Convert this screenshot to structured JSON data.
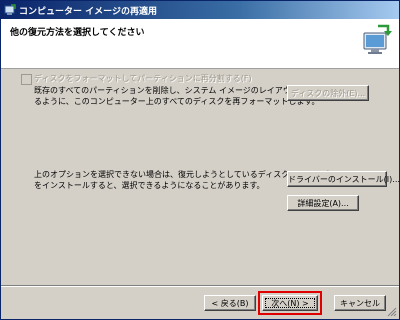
{
  "window": {
    "title": "コンピューター イメージの再適用",
    "icon": "restore-icon"
  },
  "header": {
    "title": "他の復元方法を選択してください",
    "icon": "computer-restore-icon"
  },
  "options": {
    "format_checkbox_label": "ディスクをフォーマットしてパーティションに再分割する(F)",
    "format_checkbox_checked": false,
    "format_description_line1": "既存のすべてのパーティションを削除し、システム イメージのレイアウトと一致す",
    "format_description_line2": "るように、このコンピューター上のすべてのディスクを再フォーマットします。",
    "exclude_disks_button": "ディスクの除外(E)...",
    "driver_description_line1": "上のオプションを選択できない場合は、復元しようとしているディスクのドライバー",
    "driver_description_line2": "をインストールすると、選択できるようになることがあります。",
    "install_driver_button": "ドライバーのインストール(I)...",
    "advanced_button": "詳細設定(A)..."
  },
  "footer": {
    "back_button": "< 戻る(B)",
    "next_button": "次へ(N) >",
    "cancel_button": "キャンセル"
  },
  "colors": {
    "highlight": "#e00000",
    "title_bar": "#0a246a"
  }
}
